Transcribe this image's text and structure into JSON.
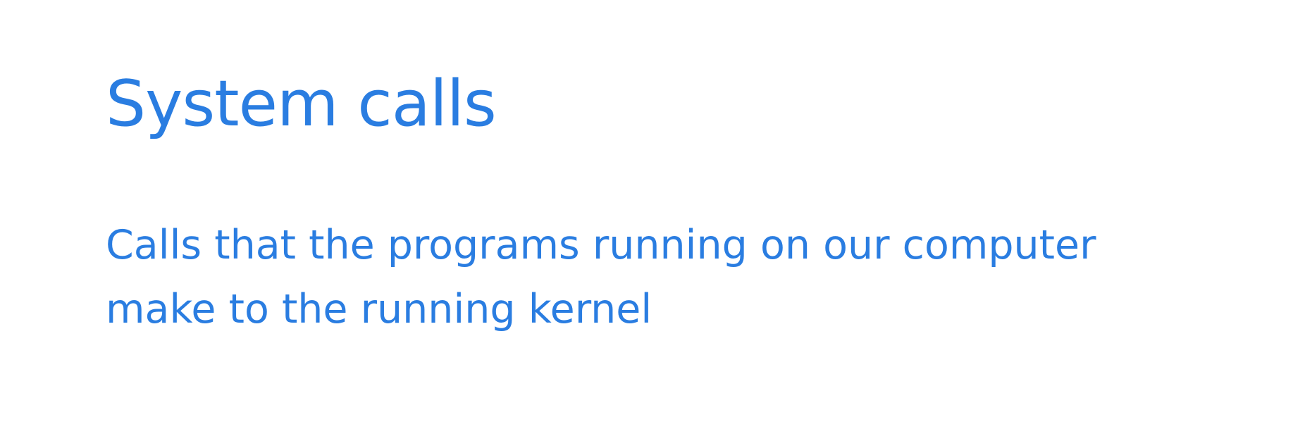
{
  "slide": {
    "title": "System calls",
    "body_lines": [
      "Calls that the programs running on our computer",
      "make to the running kernel"
    ]
  },
  "colors": {
    "background": "#ffffff",
    "text": "#2a7de1"
  }
}
